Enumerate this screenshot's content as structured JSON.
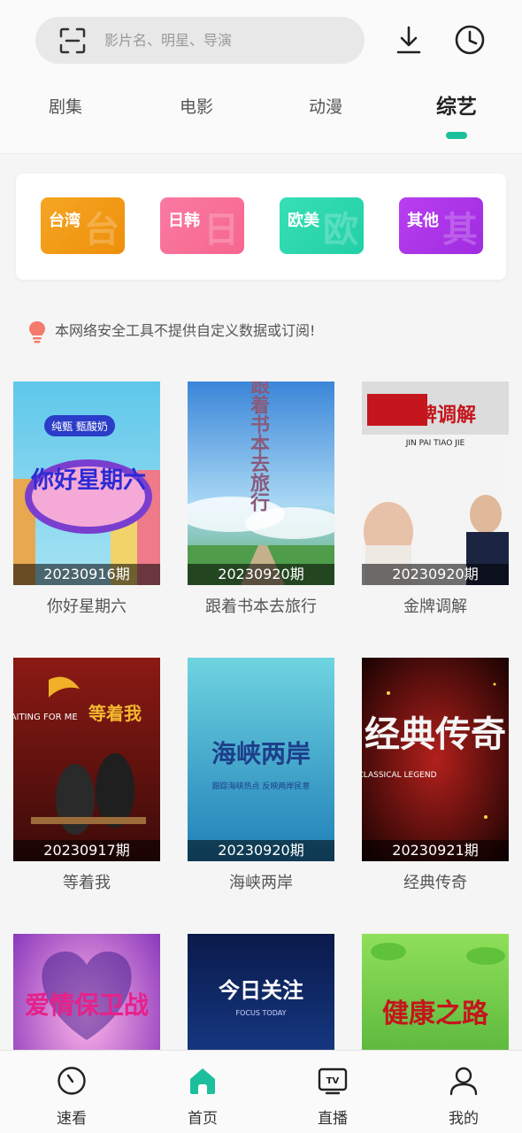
{
  "search": {
    "placeholder": "影片名、明星、导演"
  },
  "tabs": [
    {
      "label": "剧集",
      "active": false
    },
    {
      "label": "电影",
      "active": false
    },
    {
      "label": "动漫",
      "active": false
    },
    {
      "label": "综艺",
      "active": true
    }
  ],
  "regions": [
    {
      "label": "台湾",
      "watermark": "台",
      "color": "#f39c12"
    },
    {
      "label": "日韩",
      "watermark": "日",
      "color": "#f8739a"
    },
    {
      "label": "欧美",
      "watermark": "欧",
      "color": "#2bd9b0"
    },
    {
      "label": "其他",
      "watermark": "其",
      "color": "#b033e6"
    }
  ],
  "notice": {
    "text": "本网络安全工具不提供自定义数据或订阅!"
  },
  "items": [
    {
      "title": "你好星期六",
      "episode": "20230916期",
      "poster_text": "你好星期六",
      "poster_subtext": "纯甄 甄酸奶"
    },
    {
      "title": "跟着书本去旅行",
      "episode": "20230920期",
      "poster_text": "跟着书本去旅行",
      "poster_subtext": ""
    },
    {
      "title": "金牌调解",
      "episode": "20230920期",
      "poster_text": "金牌调解",
      "poster_subtext": "JIN PAI TIAO JIE"
    },
    {
      "title": "等着我",
      "episode": "20230917期",
      "poster_text": "等着我",
      "poster_subtext": "WAITING FOR ME"
    },
    {
      "title": "海峡两岸",
      "episode": "20230920期",
      "poster_text": "海峡两岸",
      "poster_subtext": "跟踪海峡热点 反映两岸民意"
    },
    {
      "title": "经典传奇",
      "episode": "20230921期",
      "poster_text": "经典传奇",
      "poster_subtext": "CLASSICAL LEGEND"
    },
    {
      "title": "",
      "episode": "",
      "poster_text": "爱情保卫战",
      "poster_subtext": ""
    },
    {
      "title": "",
      "episode": "",
      "poster_text": "今日关注",
      "poster_subtext": "FOCUS TODAY"
    },
    {
      "title": "",
      "episode": "",
      "poster_text": "健康之路",
      "poster_subtext": ""
    }
  ],
  "bottom_nav": [
    {
      "label": "速看",
      "icon": "clock-icon"
    },
    {
      "label": "首页",
      "icon": "home-icon",
      "active": true
    },
    {
      "label": "直播",
      "icon": "tv-icon"
    },
    {
      "label": "我的",
      "icon": "user-icon"
    }
  ],
  "colors": {
    "accent": "#1cbf9c"
  }
}
